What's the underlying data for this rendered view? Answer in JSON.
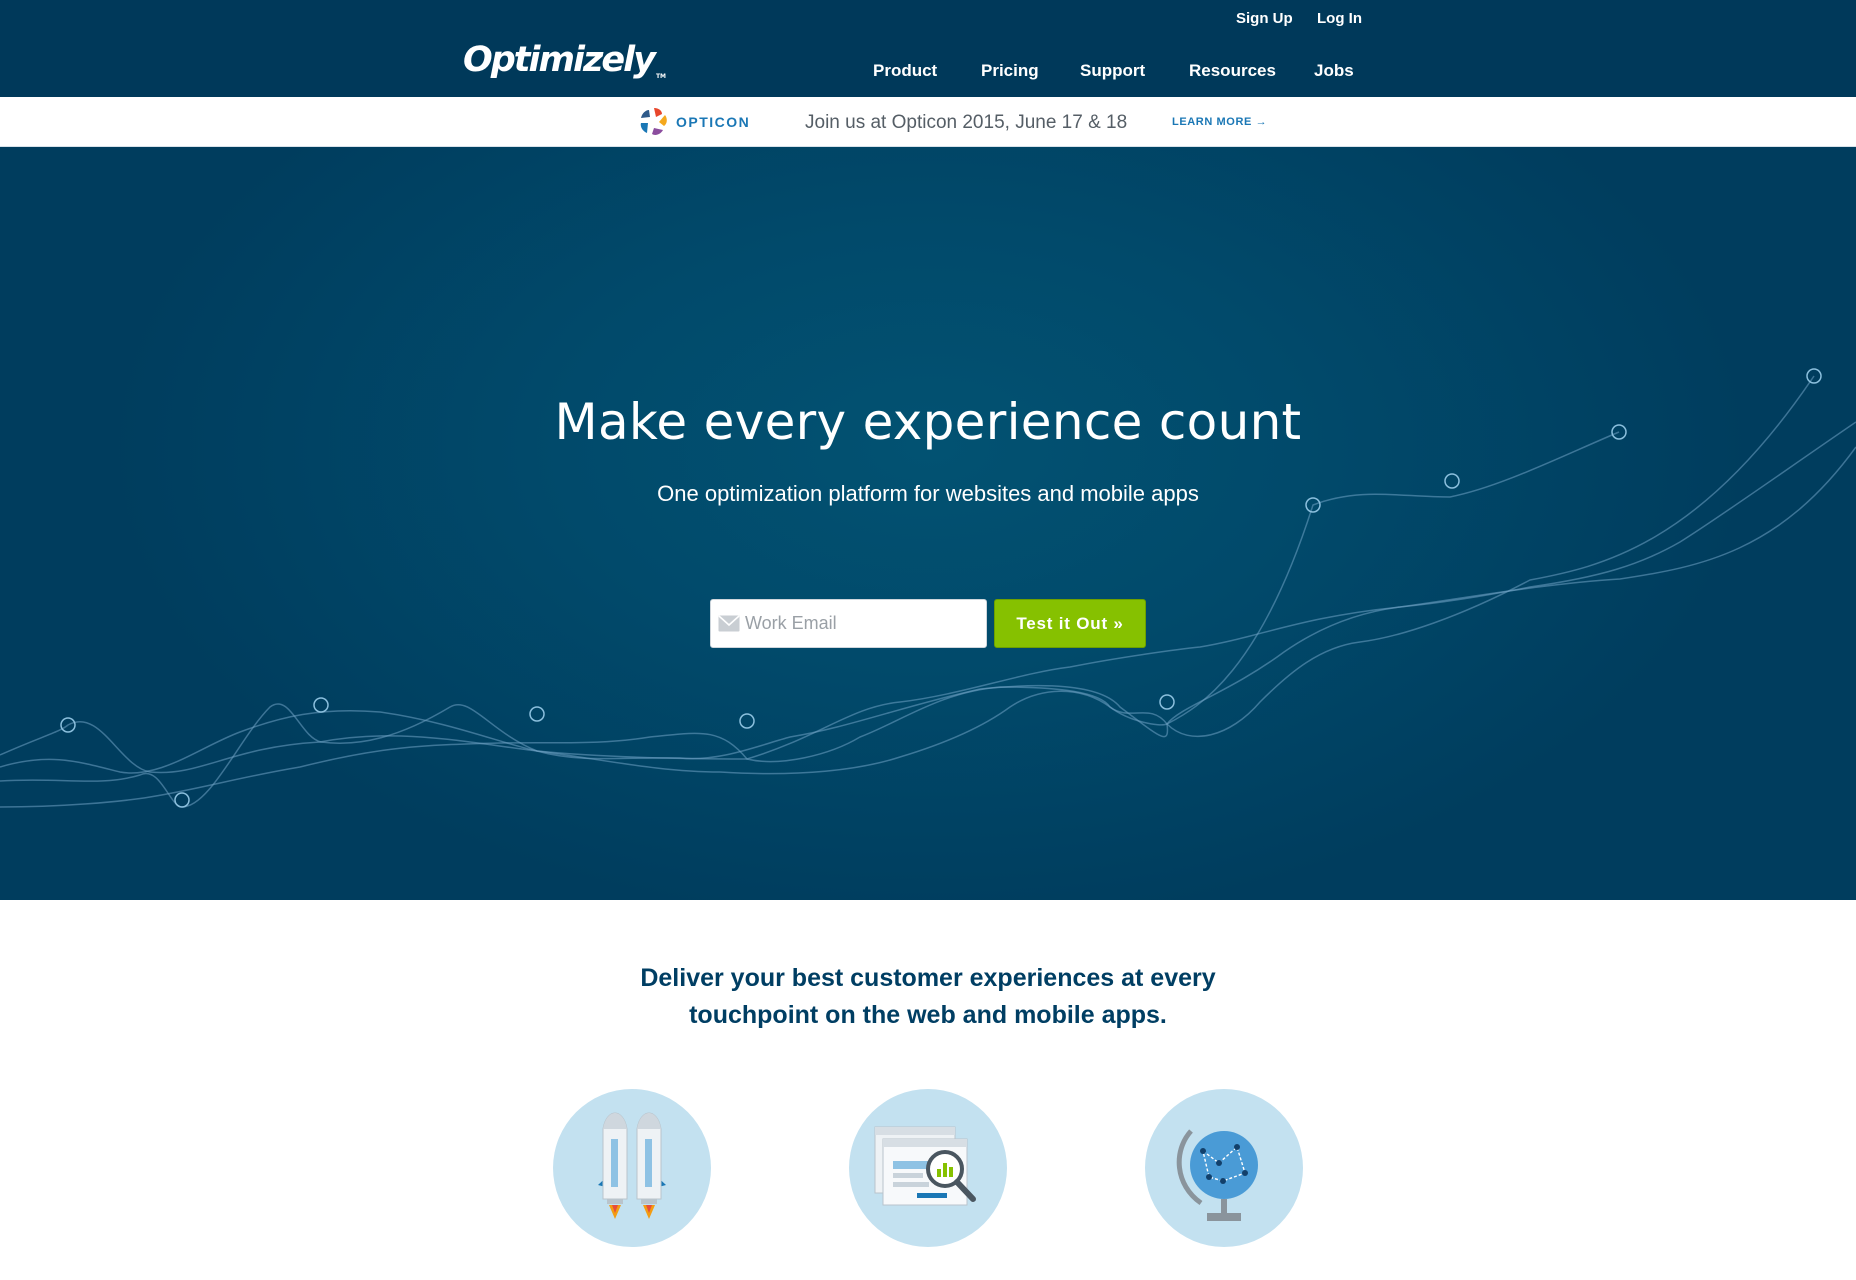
{
  "header": {
    "logo_text": "Optimizely",
    "logo_tm": "TM",
    "utility": {
      "sign_up": "Sign Up",
      "log_in": "Log In"
    },
    "nav": [
      {
        "label": "Product"
      },
      {
        "label": "Pricing"
      },
      {
        "label": "Support"
      },
      {
        "label": "Resources"
      },
      {
        "label": "Jobs"
      }
    ]
  },
  "promo": {
    "brand": "OPTICON",
    "text": "Join us at Opticon 2015, June 17 & 18",
    "link": "LEARN MORE →"
  },
  "hero": {
    "title": "Make every experience count",
    "subtitle": "One optimization platform for websites and mobile apps",
    "email_placeholder": "Work Email",
    "cta": "Test it Out »"
  },
  "features": {
    "heading_line1": "Deliver your best customer experiences at every",
    "heading_line2": "touchpoint on the web and mobile apps.",
    "icons": [
      "rocket-icon",
      "browser-analytics-icon",
      "globe-icon"
    ]
  },
  "colors": {
    "header_bg": "#00395a",
    "hero_bg": "#014a6b",
    "cta_green": "#86c100",
    "link_blue": "#1a77b5",
    "heading_navy": "#003e63",
    "icon_circle": "#c3e1f0"
  }
}
